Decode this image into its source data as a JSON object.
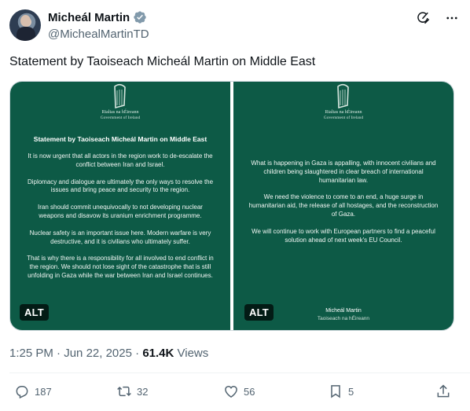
{
  "author": {
    "name": "Micheál Martin",
    "handle": "@MichealMartinTD"
  },
  "tweet": {
    "text": "Statement by Taoiseach Micheál Martin on Middle East"
  },
  "media": {
    "left": {
      "gov_irish": "Rialtas na hÉireann",
      "gov_english": "Government of Ireland",
      "title": "Statement by Taoiseach Micheál Martin on Middle East",
      "paragraphs": [
        "It is now urgent that all actors in the region work to de-escalate the conflict between Iran and Israel.",
        "Diplomacy and dialogue are ultimately the only ways to resolve the issues and bring peace and security to the region.",
        "Iran should commit unequivocally to not developing nuclear weapons and disavow its uranium enrichment programme.",
        "Nuclear safety is an important issue here. Modern warfare is very destructive, and it is civilians who ultimately suffer.",
        "That is why there is a responsibility for all involved to end conflict in the region. We should not lose sight of the catastrophe that is still unfolding in Gaza while the war between Iran and Israel continues."
      ],
      "alt_label": "ALT"
    },
    "right": {
      "gov_irish": "Rialtas na hÉireann",
      "gov_english": "Government of Ireland",
      "paragraphs": [
        "What is happening in Gaza is appalling, with innocent civilians and children being slaughtered in clear breach of international humanitarian law.",
        "We need the violence to come to an end, a huge surge in humanitarian aid, the release of all hostages, and the reconstruction of Gaza.",
        "We will continue to work with European partners to find a peaceful solution ahead of next week's EU Council."
      ],
      "signature_name": "Micheál Martin",
      "signature_role": "Taoiseach na hÉireann",
      "alt_label": "ALT"
    }
  },
  "meta": {
    "time": "1:25 PM",
    "dot": "·",
    "date": "Jun 22, 2025",
    "views_count": "61.4K",
    "views_label": "Views"
  },
  "actions": {
    "replies": "187",
    "reposts": "32",
    "likes": "56",
    "bookmarks": "5"
  },
  "icons": {
    "verified": "verified-badge-icon",
    "grok": "grok-icon",
    "more": "more-icon",
    "reply": "reply-icon",
    "repost": "repost-icon",
    "like": "heart-icon",
    "bookmark": "bookmark-icon",
    "share": "share-icon",
    "harp": "harp-icon"
  },
  "colors": {
    "panel_green": "#0d5a46",
    "verified_gray": "#829aab",
    "secondary_text": "#536471"
  }
}
